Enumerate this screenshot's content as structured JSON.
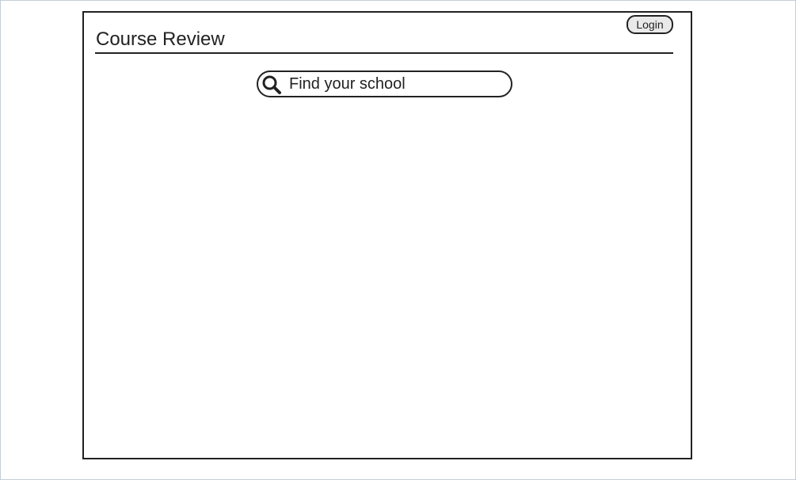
{
  "header": {
    "title": "Course Review",
    "login_label": "Login"
  },
  "search": {
    "placeholder": "Find your school",
    "icon": "search-icon"
  },
  "colors": {
    "stroke": "#222222",
    "button_fill": "#e9e9e9",
    "outer_border": "#c5cdd6"
  }
}
